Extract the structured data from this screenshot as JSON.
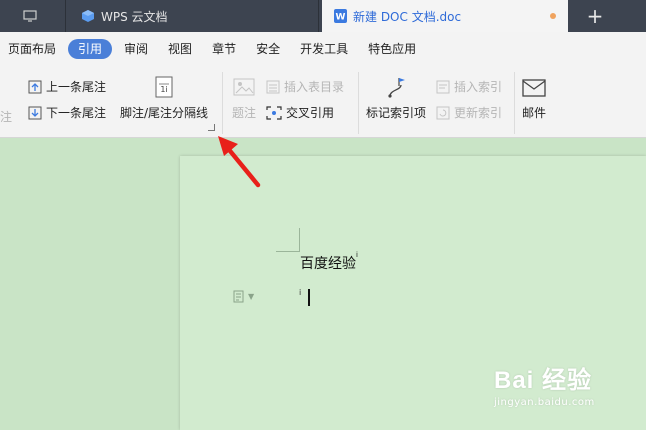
{
  "tabs": {
    "home": {
      "icon": "monitor-icon"
    },
    "wps": {
      "label": "WPS 云文档",
      "icon": "cube-icon"
    },
    "doc": {
      "label": "新建 DOC 文档.doc",
      "icon": "word-doc-icon",
      "accent": "#2f6bd8"
    },
    "add": {
      "label": "+"
    }
  },
  "menu": {
    "items": [
      "页面布局",
      "引用",
      "审阅",
      "视图",
      "章节",
      "安全",
      "开发工具",
      "特色应用"
    ],
    "active_index": 1,
    "accent": "#4a7fd8"
  },
  "ribbon": {
    "partial_left": "注",
    "prev_endnote": "上一条尾注",
    "next_endnote": "下一条尾注",
    "separator_line": "脚注/尾注分隔线",
    "caption": "题注",
    "insert_toc_of_tables": "插入表目录",
    "cross_reference": "交叉引用",
    "mark_index": "标记索引项",
    "insert_index": "插入索引",
    "update_index": "更新索引",
    "mail": "邮件"
  },
  "document": {
    "text": "百度经验",
    "superscript": "i",
    "endnote_marker": "i"
  },
  "watermark": {
    "logo_text": "Bai 经验",
    "url": "jingyan.baidu.com"
  }
}
